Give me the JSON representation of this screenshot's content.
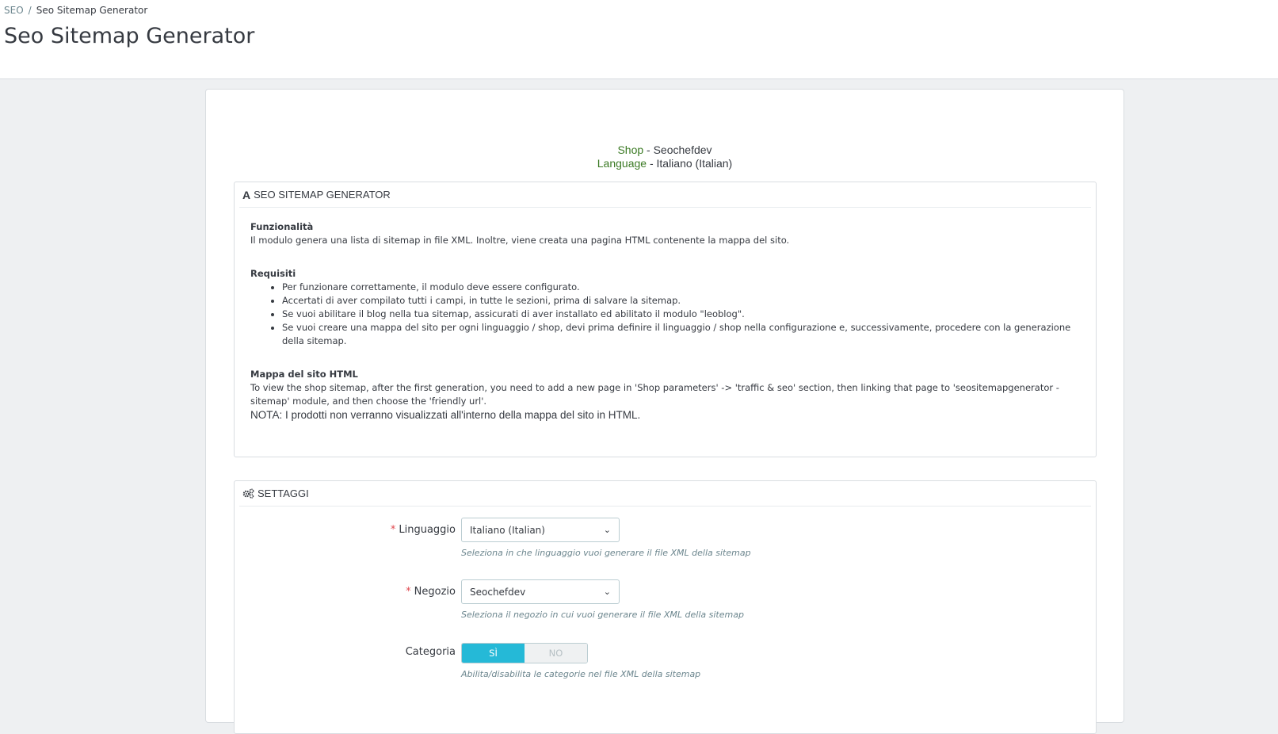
{
  "breadcrumb": {
    "root": "SEO",
    "separator": "/",
    "current": "Seo Sitemap Generator"
  },
  "page_title": "Seo Sitemap Generator",
  "shop_info": {
    "shop_label": "Shop",
    "shop_value": " - Seochefdev",
    "language_label": "Language",
    "language_value": " - Italiano (Italian)"
  },
  "info_panel": {
    "icon": "font-a-icon",
    "title": "SEO SITEMAP GENERATOR",
    "funzionalita_title": "Funzionalità",
    "funzionalita_text": "Il modulo genera una lista di sitemap in file XML. Inoltre, viene creata una pagina HTML contenente la mappa del sito.",
    "requisiti_title": "Requisiti",
    "requisiti_items": [
      "Per funzionare correttamente, il modulo deve essere configurato.",
      "Accertati di aver compilato tutti i campi, in tutte le sezioni, prima di salvare la sitemap.",
      "Se vuoi abilitare il blog nella tua sitemap, assicurati di aver installato ed abilitato il modulo \"leoblog\".",
      "Se vuoi creare una mappa del sito per ogni linguaggio / shop, devi prima definire il linguaggio / shop nella configurazione e, successivamente, procedere con la generazione della sitemap."
    ],
    "mappa_title": "Mappa del sito HTML",
    "mappa_text": "To view the shop sitemap, after the first generation, you need to add a new page in 'Shop parameters' -> 'traffic & seo' section, then linking that page to 'seositemapgenerator - sitemap' module, and then choose the 'friendly url'.",
    "nota": "NOTA: I prodotti non verranno visualizzati all'interno della mappa del sito in HTML."
  },
  "settings_panel": {
    "icon": "cogs-icon",
    "title": "SETTAGGI",
    "required_mark": "*",
    "linguaggio": {
      "label": "Linguaggio",
      "selected": "Italiano (Italian)",
      "help": "Seleziona in che linguaggio vuoi generare il file XML della sitemap"
    },
    "negozio": {
      "label": "Negozio",
      "selected": "Seochefdev",
      "help": "Seleziona il negozio in cui vuoi generare il file XML della sitemap"
    },
    "categoria": {
      "label": "Categoria",
      "yes": "SÌ",
      "no": "NO",
      "help": "Abilita/disabilita le categorie nel file XML della sitemap"
    }
  }
}
